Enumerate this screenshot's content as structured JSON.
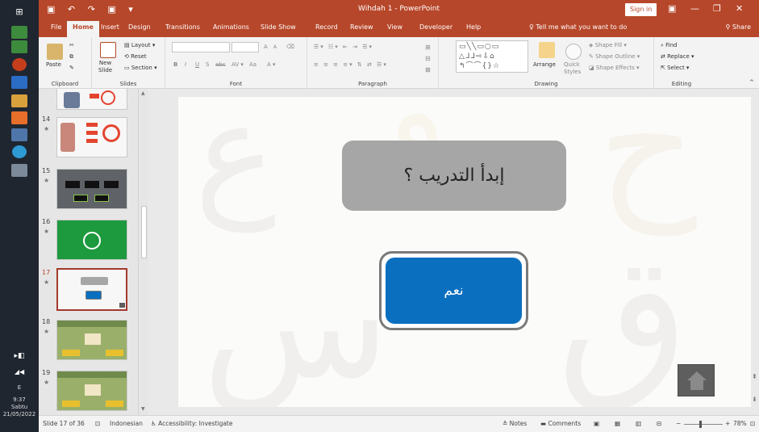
{
  "window": {
    "title": "Wihdah 1  -  PowerPoint",
    "sign_in": "Sign in",
    "minimize": "—",
    "restore": "❐",
    "close": "✕"
  },
  "tabs": [
    "File",
    "Home",
    "Insert",
    "Design",
    "Transitions",
    "Animations",
    "Slide Show",
    "Record",
    "Review",
    "View",
    "Developer",
    "Help"
  ],
  "tell_me": "Tell me what you want to do",
  "share": "Share",
  "ribbon": {
    "clipboard": {
      "label": "Clipboard",
      "paste": "Paste"
    },
    "slides": {
      "label": "Slides",
      "new_slide": "New\nSlide",
      "layout": "Layout",
      "reset": "Reset",
      "section": "Section"
    },
    "font": {
      "label": "Font",
      "bold": "B",
      "italic": "I",
      "underline": "U",
      "strike": "S",
      "spacing": "abc",
      "case": "Aa",
      "grow": "A",
      "shrink": "A"
    },
    "paragraph": {
      "label": "Paragraph"
    },
    "drawing": {
      "label": "Drawing",
      "arrange": "Arrange",
      "quick_styles": "Quick\nStyles",
      "shape_fill": "Shape Fill",
      "shape_outline": "Shape Outline",
      "shape_effects": "Shape Effects"
    },
    "editing": {
      "label": "Editing",
      "find": "Find",
      "replace": "Replace",
      "select": "Select"
    }
  },
  "slides_panel": [
    {
      "num": "14",
      "star": "★"
    },
    {
      "num": "15",
      "star": "★"
    },
    {
      "num": "16",
      "star": "★"
    },
    {
      "num": "17",
      "star": "★"
    },
    {
      "num": "18",
      "star": "★"
    },
    {
      "num": "19",
      "star": "★"
    }
  ],
  "slide": {
    "question": "إبدأ التدريب ؟",
    "yes_button": "نعم"
  },
  "status": {
    "slide_info": "Slide 17 of 36",
    "language": "Indonesian",
    "accessibility": "Accessibility: Investigate",
    "notes": "Notes",
    "comments": "Comments",
    "zoom": "78%"
  },
  "taskbar": {
    "time": "9:37",
    "day": "Sabtu",
    "date": "21/05/2022"
  },
  "colors": {
    "accent": "#b7472a",
    "button_blue": "#0b6fc0",
    "question_gray": "#a6a6a6"
  }
}
